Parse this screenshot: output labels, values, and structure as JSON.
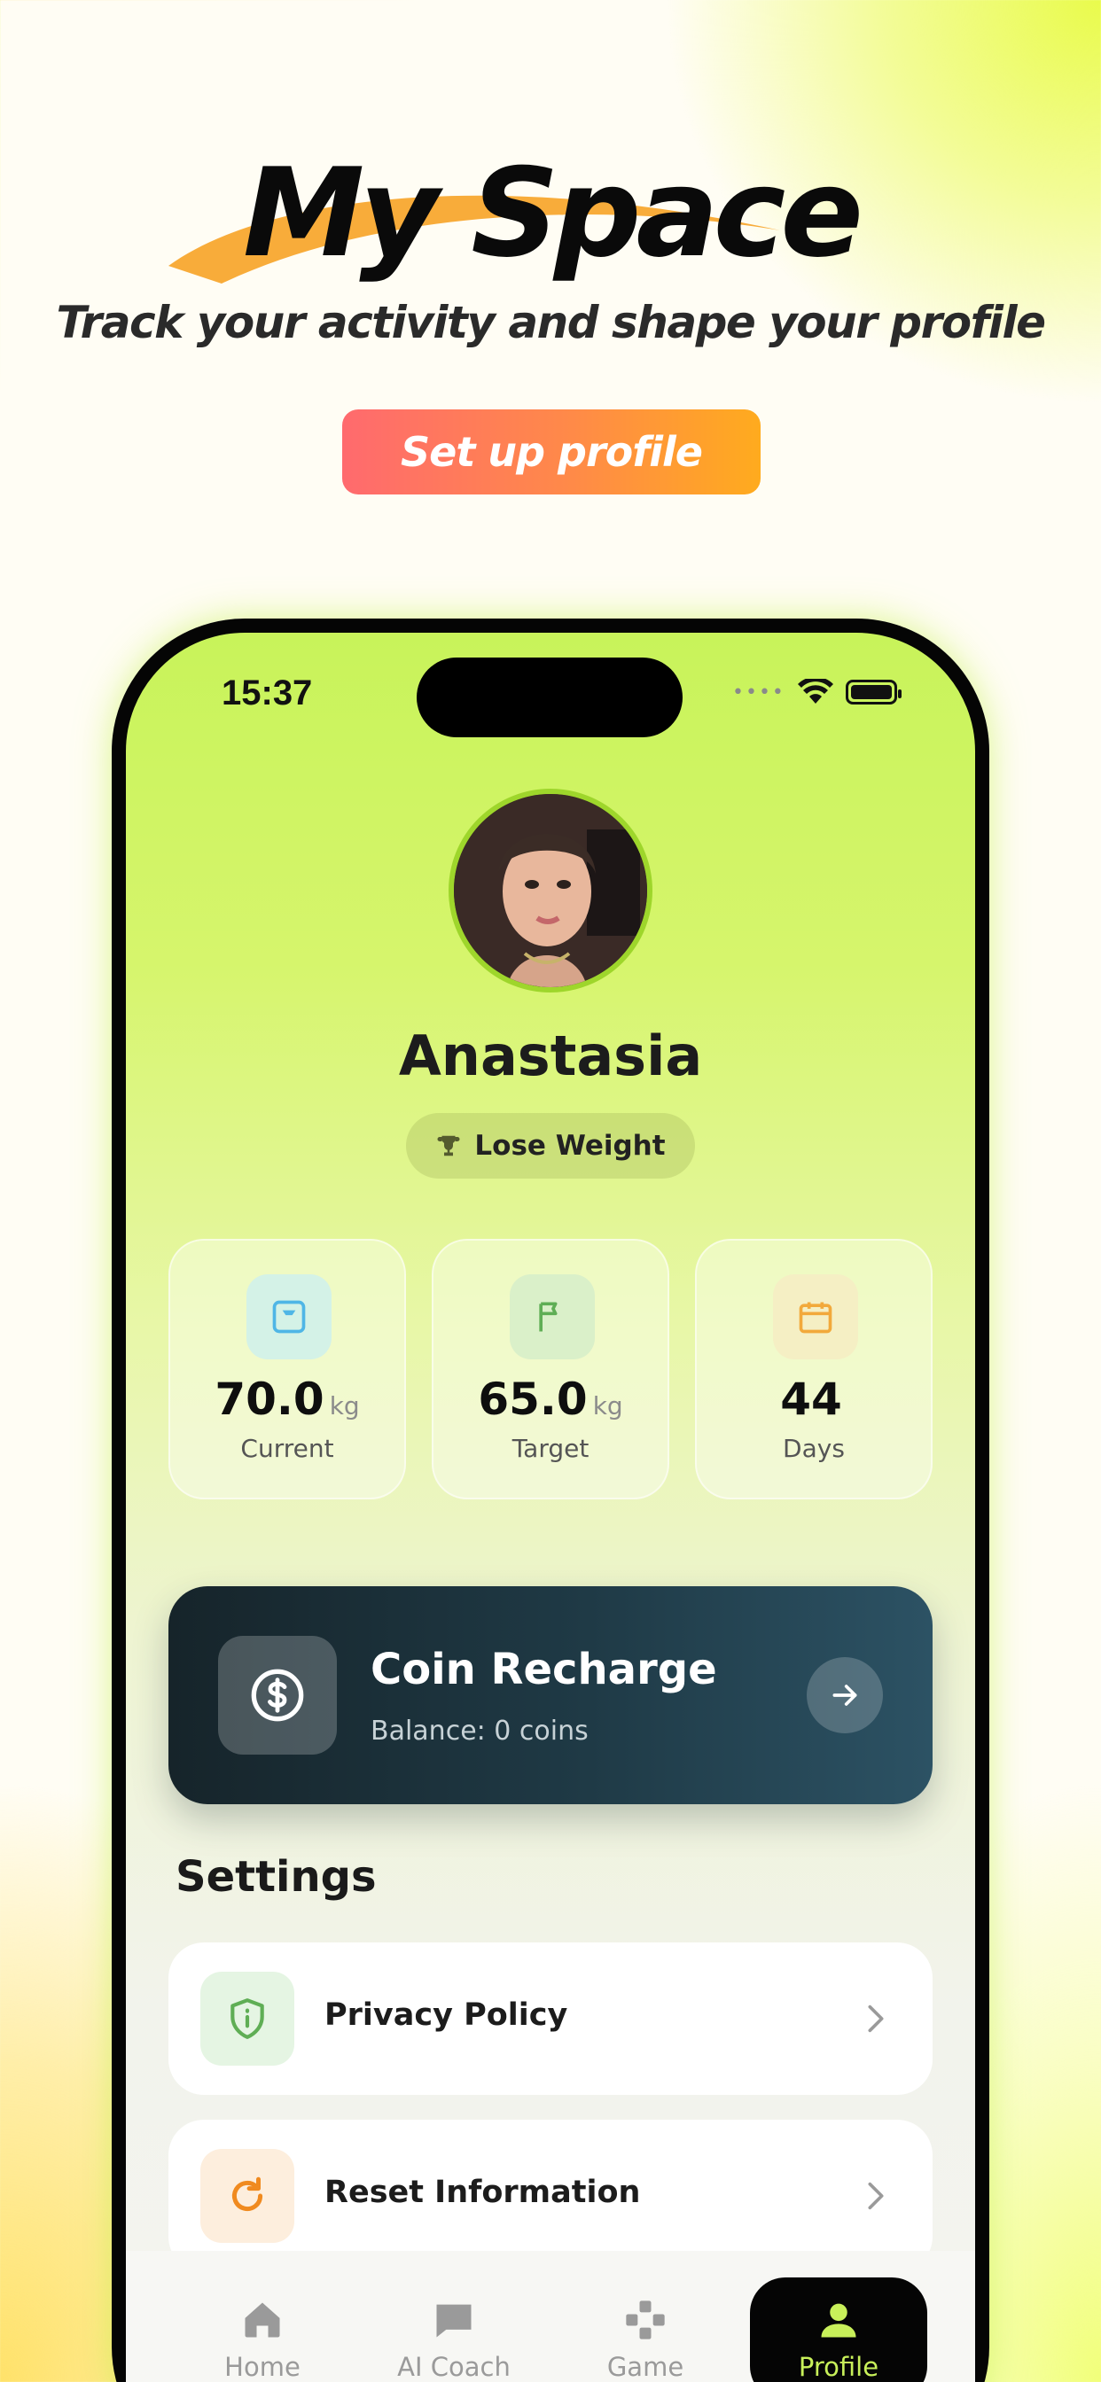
{
  "promo": {
    "title": "My Space",
    "subtitle": "Track your activity and shape your profile",
    "cta_label": "Set up profile"
  },
  "status_bar": {
    "time": "15:37"
  },
  "profile": {
    "name": "Anastasia",
    "goal": "Lose Weight"
  },
  "stats": [
    {
      "value": "70.0",
      "unit": "kg",
      "label": "Current",
      "icon": "scale-icon",
      "icon_color": "#4fb6e6",
      "icon_bg": "#d4f2e7"
    },
    {
      "value": "65.0",
      "unit": "kg",
      "label": "Target",
      "icon": "flag-icon",
      "icon_color": "#5fae55",
      "icon_bg": "#daf0c9"
    },
    {
      "value": "44",
      "unit": "",
      "label": "Days",
      "icon": "calendar-icon",
      "icon_color": "#f2a93b",
      "icon_bg": "#f5efc4"
    }
  ],
  "coin_card": {
    "title": "Coin Recharge",
    "balance": "Balance: 0 coins"
  },
  "settings": {
    "heading": "Settings",
    "items": [
      {
        "label": "Privacy Policy",
        "icon": "shield-info-icon",
        "icon_color": "#5fae55",
        "icon_bg": "#e5f5e3"
      },
      {
        "label": "Reset Information",
        "icon": "refresh-icon",
        "icon_color": "#f08a1f",
        "icon_bg": "#fdeedd"
      }
    ]
  },
  "tab_bar": {
    "tabs": [
      {
        "label": "Home",
        "icon": "home-icon",
        "active": false
      },
      {
        "label": "AI Coach",
        "icon": "chat-icon",
        "active": false
      },
      {
        "label": "Game",
        "icon": "gamepad-icon",
        "active": false
      },
      {
        "label": "Profile",
        "icon": "person-icon",
        "active": true
      }
    ]
  },
  "colors": {
    "accent_green": "#c8f05a",
    "cta_gradient_start": "#ff6a6e",
    "cta_gradient_end": "#ffab1e",
    "coin_card_dark": "#16242a"
  }
}
